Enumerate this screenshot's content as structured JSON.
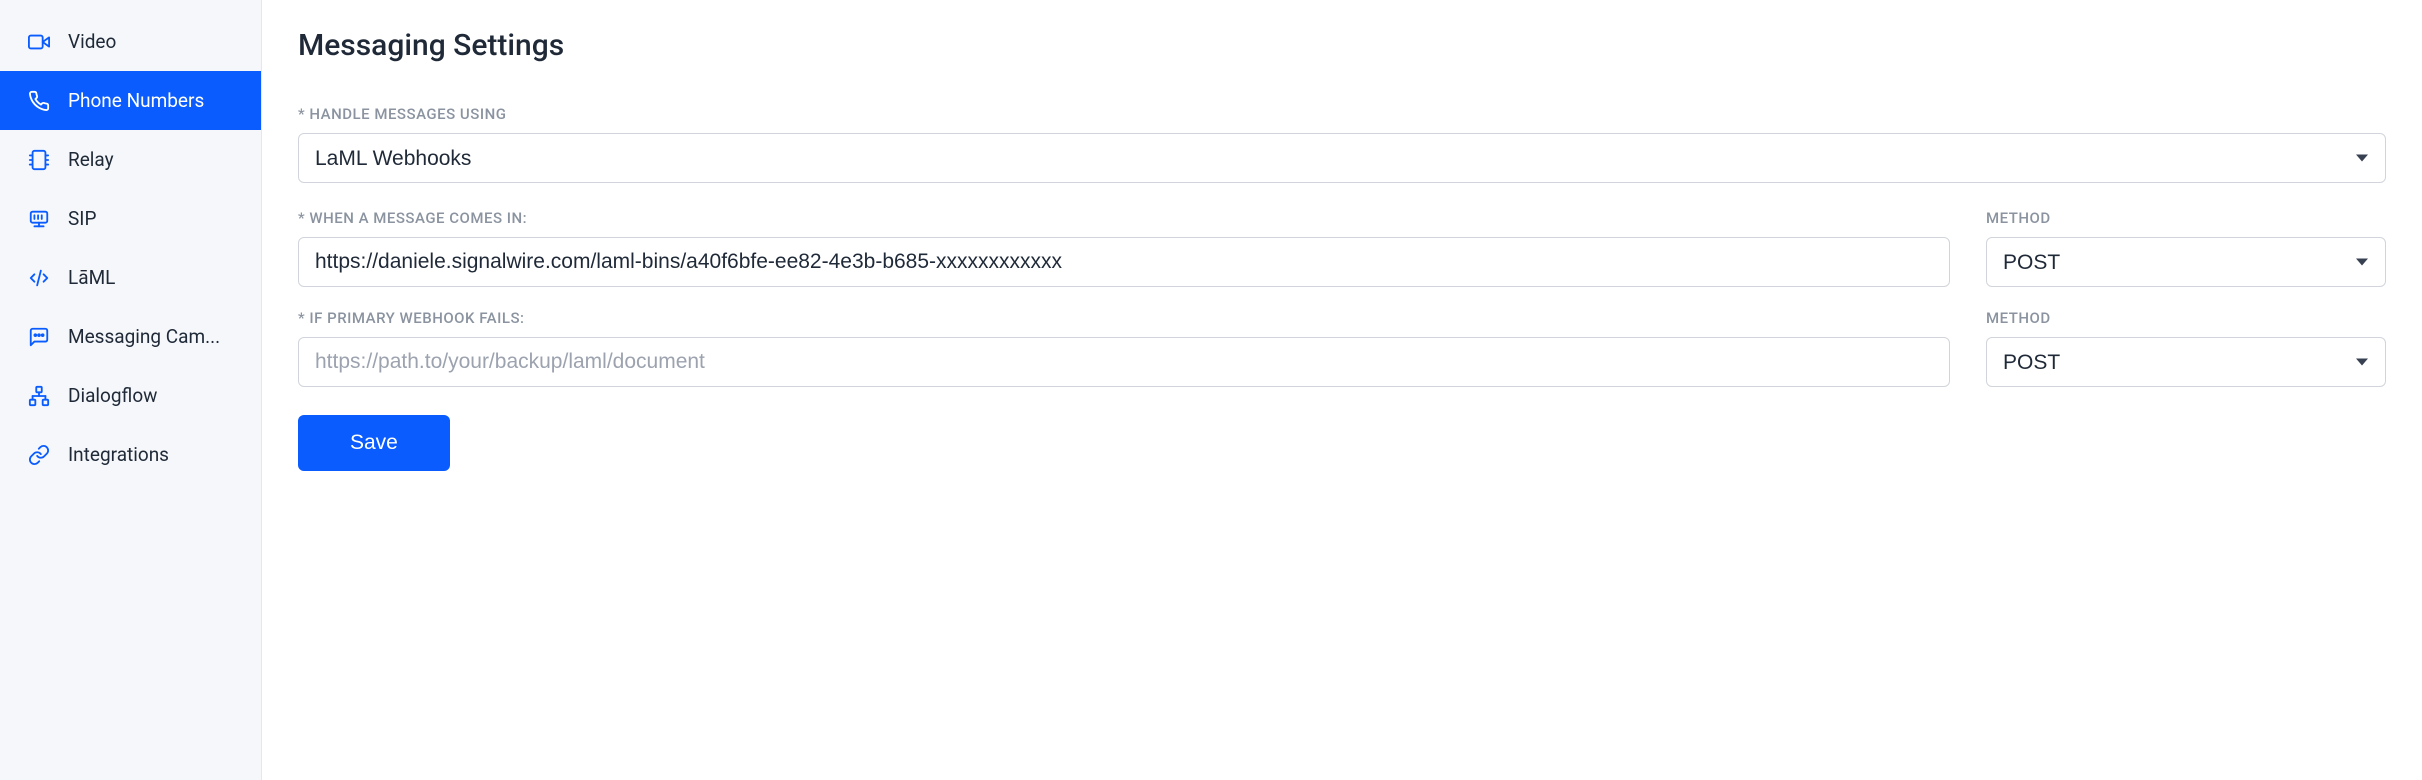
{
  "sidebar": {
    "items": [
      {
        "label": "Video"
      },
      {
        "label": "Phone Numbers"
      },
      {
        "label": "Relay"
      },
      {
        "label": "SIP"
      },
      {
        "label": "LāML"
      },
      {
        "label": "Messaging Cam..."
      },
      {
        "label": "Dialogflow"
      },
      {
        "label": "Integrations"
      }
    ]
  },
  "main": {
    "title": "Messaging Settings",
    "handle_label": "* HANDLE MESSAGES USING",
    "handle_value": "LaML Webhooks",
    "primary_label": "* WHEN A MESSAGE COMES IN:",
    "primary_value": "https://daniele.signalwire.com/laml-bins/a40f6bfe-ee82-4e3b-b685-xxxxxxxxxxxx",
    "primary_method_label": "METHOD",
    "primary_method_value": "POST",
    "backup_label": "* IF PRIMARY WEBHOOK FAILS:",
    "backup_placeholder": "https://path.to/your/backup/laml/document",
    "backup_method_label": "METHOD",
    "backup_method_value": "POST",
    "save_label": "Save"
  }
}
